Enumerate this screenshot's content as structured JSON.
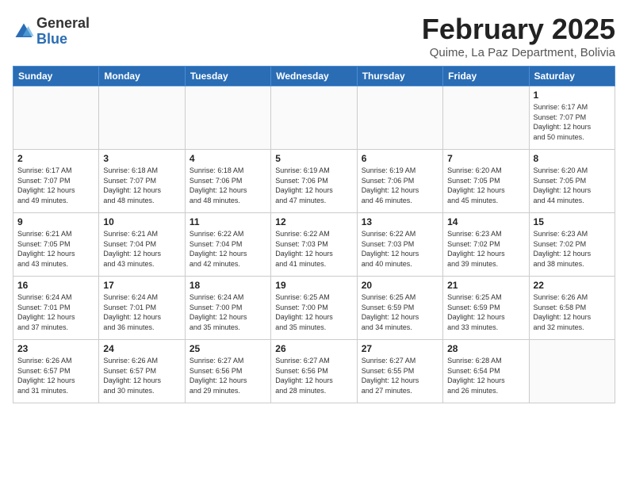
{
  "header": {
    "logo_general": "General",
    "logo_blue": "Blue",
    "month": "February 2025",
    "location": "Quime, La Paz Department, Bolivia"
  },
  "weekdays": [
    "Sunday",
    "Monday",
    "Tuesday",
    "Wednesday",
    "Thursday",
    "Friday",
    "Saturday"
  ],
  "weeks": [
    [
      {
        "day": "",
        "info": ""
      },
      {
        "day": "",
        "info": ""
      },
      {
        "day": "",
        "info": ""
      },
      {
        "day": "",
        "info": ""
      },
      {
        "day": "",
        "info": ""
      },
      {
        "day": "",
        "info": ""
      },
      {
        "day": "1",
        "info": "Sunrise: 6:17 AM\nSunset: 7:07 PM\nDaylight: 12 hours\nand 50 minutes."
      }
    ],
    [
      {
        "day": "2",
        "info": "Sunrise: 6:17 AM\nSunset: 7:07 PM\nDaylight: 12 hours\nand 49 minutes."
      },
      {
        "day": "3",
        "info": "Sunrise: 6:18 AM\nSunset: 7:07 PM\nDaylight: 12 hours\nand 48 minutes."
      },
      {
        "day": "4",
        "info": "Sunrise: 6:18 AM\nSunset: 7:06 PM\nDaylight: 12 hours\nand 48 minutes."
      },
      {
        "day": "5",
        "info": "Sunrise: 6:19 AM\nSunset: 7:06 PM\nDaylight: 12 hours\nand 47 minutes."
      },
      {
        "day": "6",
        "info": "Sunrise: 6:19 AM\nSunset: 7:06 PM\nDaylight: 12 hours\nand 46 minutes."
      },
      {
        "day": "7",
        "info": "Sunrise: 6:20 AM\nSunset: 7:05 PM\nDaylight: 12 hours\nand 45 minutes."
      },
      {
        "day": "8",
        "info": "Sunrise: 6:20 AM\nSunset: 7:05 PM\nDaylight: 12 hours\nand 44 minutes."
      }
    ],
    [
      {
        "day": "9",
        "info": "Sunrise: 6:21 AM\nSunset: 7:05 PM\nDaylight: 12 hours\nand 43 minutes."
      },
      {
        "day": "10",
        "info": "Sunrise: 6:21 AM\nSunset: 7:04 PM\nDaylight: 12 hours\nand 43 minutes."
      },
      {
        "day": "11",
        "info": "Sunrise: 6:22 AM\nSunset: 7:04 PM\nDaylight: 12 hours\nand 42 minutes."
      },
      {
        "day": "12",
        "info": "Sunrise: 6:22 AM\nSunset: 7:03 PM\nDaylight: 12 hours\nand 41 minutes."
      },
      {
        "day": "13",
        "info": "Sunrise: 6:22 AM\nSunset: 7:03 PM\nDaylight: 12 hours\nand 40 minutes."
      },
      {
        "day": "14",
        "info": "Sunrise: 6:23 AM\nSunset: 7:02 PM\nDaylight: 12 hours\nand 39 minutes."
      },
      {
        "day": "15",
        "info": "Sunrise: 6:23 AM\nSunset: 7:02 PM\nDaylight: 12 hours\nand 38 minutes."
      }
    ],
    [
      {
        "day": "16",
        "info": "Sunrise: 6:24 AM\nSunset: 7:01 PM\nDaylight: 12 hours\nand 37 minutes."
      },
      {
        "day": "17",
        "info": "Sunrise: 6:24 AM\nSunset: 7:01 PM\nDaylight: 12 hours\nand 36 minutes."
      },
      {
        "day": "18",
        "info": "Sunrise: 6:24 AM\nSunset: 7:00 PM\nDaylight: 12 hours\nand 35 minutes."
      },
      {
        "day": "19",
        "info": "Sunrise: 6:25 AM\nSunset: 7:00 PM\nDaylight: 12 hours\nand 35 minutes."
      },
      {
        "day": "20",
        "info": "Sunrise: 6:25 AM\nSunset: 6:59 PM\nDaylight: 12 hours\nand 34 minutes."
      },
      {
        "day": "21",
        "info": "Sunrise: 6:25 AM\nSunset: 6:59 PM\nDaylight: 12 hours\nand 33 minutes."
      },
      {
        "day": "22",
        "info": "Sunrise: 6:26 AM\nSunset: 6:58 PM\nDaylight: 12 hours\nand 32 minutes."
      }
    ],
    [
      {
        "day": "23",
        "info": "Sunrise: 6:26 AM\nSunset: 6:57 PM\nDaylight: 12 hours\nand 31 minutes."
      },
      {
        "day": "24",
        "info": "Sunrise: 6:26 AM\nSunset: 6:57 PM\nDaylight: 12 hours\nand 30 minutes."
      },
      {
        "day": "25",
        "info": "Sunrise: 6:27 AM\nSunset: 6:56 PM\nDaylight: 12 hours\nand 29 minutes."
      },
      {
        "day": "26",
        "info": "Sunrise: 6:27 AM\nSunset: 6:56 PM\nDaylight: 12 hours\nand 28 minutes."
      },
      {
        "day": "27",
        "info": "Sunrise: 6:27 AM\nSunset: 6:55 PM\nDaylight: 12 hours\nand 27 minutes."
      },
      {
        "day": "28",
        "info": "Sunrise: 6:28 AM\nSunset: 6:54 PM\nDaylight: 12 hours\nand 26 minutes."
      },
      {
        "day": "",
        "info": ""
      }
    ]
  ]
}
